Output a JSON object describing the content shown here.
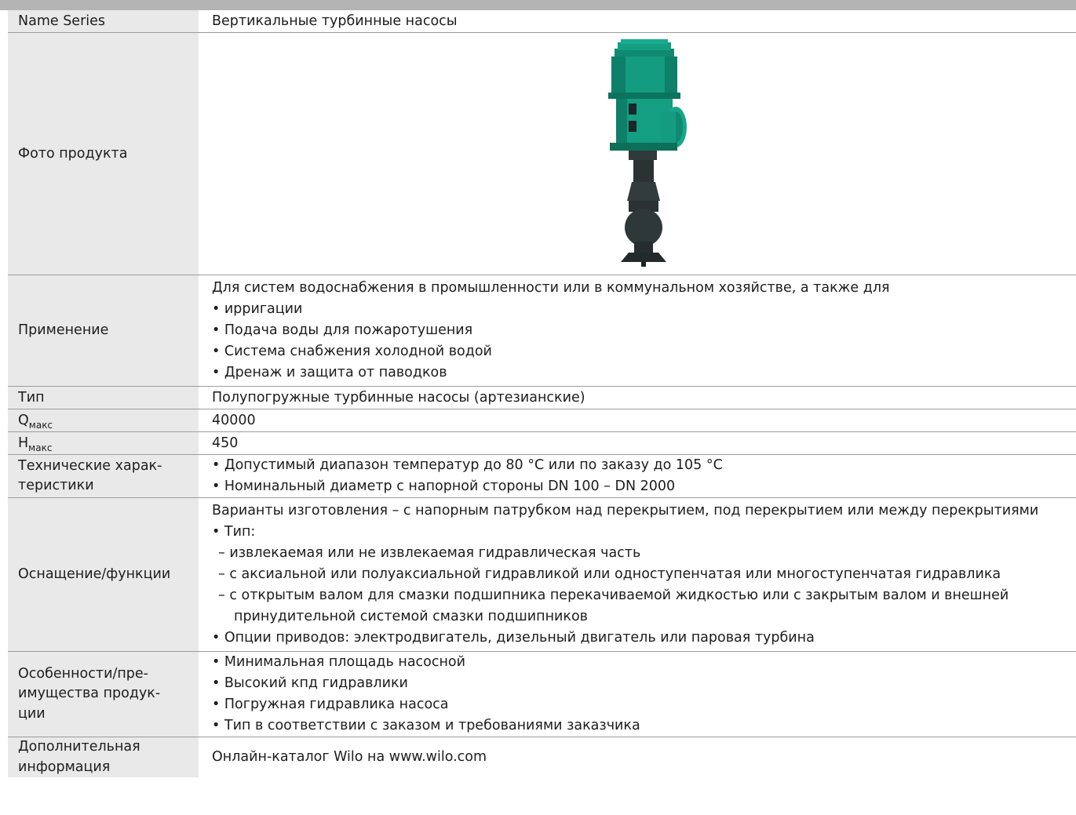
{
  "colors": {
    "header_bar": "#b4b4b4",
    "label_bg": "#e9e9e9",
    "pump_green": "#139c80",
    "pump_dark": "#2a3233"
  },
  "rows": {
    "name_series": {
      "label": "Name Series",
      "value": "Вертикальные турбинные насосы"
    },
    "photo": {
      "label": "Фото продукта",
      "icon": "vertical-turbine-pump-image"
    },
    "application": {
      "label": "Применение",
      "intro": "Для систем водоснабжения в промышленности или в коммунальном хозяйстве, а также для",
      "items": [
        "ирригации",
        "Подача воды для пожаротушения",
        "Система снабжения холодной водой",
        "Дренаж и защита от паводков"
      ]
    },
    "type": {
      "label": "Тип",
      "value": "Полупогружные турбинные насосы (артезианские)"
    },
    "qmax": {
      "label_main": "Q",
      "label_sub": "макс",
      "value": "40000"
    },
    "hmax": {
      "label_main": "H",
      "label_sub": "макс",
      "value": "450"
    },
    "tech": {
      "label_line1": "Технические харак-",
      "label_line2": "теристики",
      "items": [
        "Допустимый диапазон температур до 80 °C или по заказу до 105 °C",
        "Номинальный диаметр с напорной стороны DN 100 – DN 2000"
      ]
    },
    "equipment": {
      "label": "Оснащение/функции",
      "intro": "Варианты изготовления – с напорным патрубком над перекрытием, под перекрытием или между перекрытиями",
      "type_item": "Тип:",
      "sub_items": [
        "извлекаемая или не извлекаемая гидравлическая часть",
        "с аксиальной или полуаксиальной гидравликой или одноступенчатая или многоступенчатая гидравлика",
        "с открытым валом для смазки подшипника перекачиваемой жидкостью или с закрытым валом и внешней"
      ],
      "sub_item_cont": "принудительной системой смазки подшипников",
      "drives_item": "Опции приводов: электродвигатель, дизельный двигатель или паровая турбина"
    },
    "features": {
      "label_line1": "Особенности/пре-",
      "label_line2": "имущества продук-",
      "label_line3": "ции",
      "items": [
        "Минимальная площадь насосной",
        "Высокий кпд гидравлики",
        "Погружная гидравлика насоса",
        "Тип в соответствии с заказом и требованиями заказчика"
      ]
    },
    "info": {
      "label_line1": "Дополнительная",
      "label_line2": "информация",
      "value": "Онлайн-каталог Wilo на www.wilo.com"
    }
  }
}
